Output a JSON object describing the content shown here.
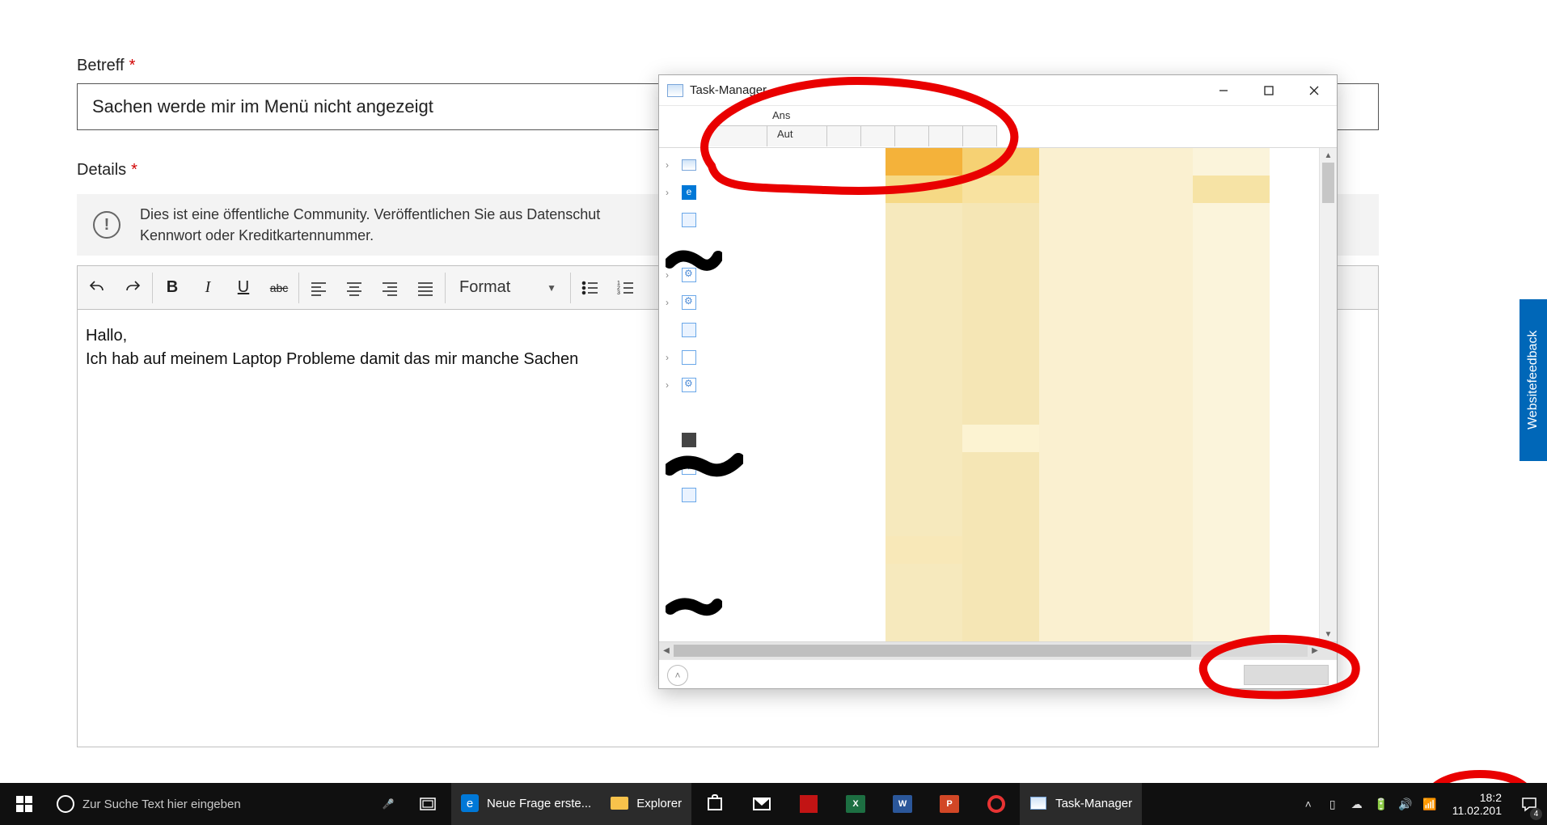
{
  "form": {
    "subject_label": "Betreff",
    "subject_value": "Sachen werde mir im Menü nicht angezeigt",
    "details_label": "Details",
    "privacy_line1": "Dies ist eine öffentliche Community. Veröffentlichen Sie aus Datenschut",
    "privacy_line2": "Kennwort oder Kreditkartennummer.",
    "editor_text_line1": "Hallo,",
    "editor_text_line2": "Ich hab auf meinem Laptop Probleme damit das mir manche Sachen",
    "format_label": "Format"
  },
  "feedback_tab": "Websitefeedback",
  "task_manager": {
    "title": "Task-Manager",
    "tab_ans": "Ans",
    "tab_aut": "Aut"
  },
  "taskbar": {
    "search_placeholder": "Zur Suche Text hier eingeben",
    "app_edge": "Neue Frage erste...",
    "app_explorer": "Explorer",
    "app_taskmanager": "Task-Manager",
    "clock_time": "18:2",
    "clock_date": "11.02.201",
    "action_count": "4",
    "app_icons": {
      "excel": "X",
      "word": "W",
      "powerpoint": "P",
      "edge_letter": "e"
    }
  }
}
